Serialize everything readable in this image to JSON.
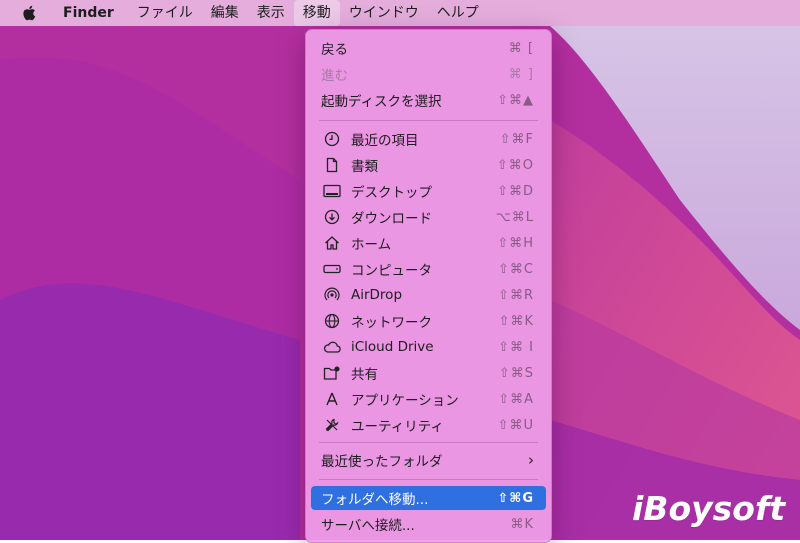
{
  "menubar": {
    "app_name": "Finder",
    "menus": [
      "ファイル",
      "編集",
      "表示",
      "移動",
      "ウインドウ",
      "ヘルプ"
    ]
  },
  "go_menu": {
    "items": [
      {
        "label": "戻る",
        "shortcut": "⌘ ["
      },
      {
        "label": "進む",
        "shortcut": "⌘ ]",
        "disabled": true
      },
      {
        "label": "起動ディスクを選択",
        "shortcut": "⇧⌘▲"
      },
      {
        "label": "最近の項目",
        "shortcut": "⇧⌘F",
        "icon": "clock-icon"
      },
      {
        "label": "書類",
        "shortcut": "⇧⌘O",
        "icon": "document-icon"
      },
      {
        "label": "デスクトップ",
        "shortcut": "⇧⌘D",
        "icon": "desktop-icon"
      },
      {
        "label": "ダウンロード",
        "shortcut": "⌥⌘L",
        "icon": "download-icon"
      },
      {
        "label": "ホーム",
        "shortcut": "⇧⌘H",
        "icon": "home-icon"
      },
      {
        "label": "コンピュータ",
        "shortcut": "⇧⌘C",
        "icon": "computer-icon"
      },
      {
        "label": "AirDrop",
        "shortcut": "⇧⌘R",
        "icon": "airdrop-icon"
      },
      {
        "label": "ネットワーク",
        "shortcut": "⇧⌘K",
        "icon": "network-icon"
      },
      {
        "label": "iCloud Drive",
        "shortcut": "⇧⌘ I",
        "icon": "cloud-icon"
      },
      {
        "label": "共有",
        "shortcut": "⇧⌘S",
        "icon": "shared-folder-icon"
      },
      {
        "label": "アプリケーション",
        "shortcut": "⇧⌘A",
        "icon": "applications-icon"
      },
      {
        "label": "ユーティリティ",
        "shortcut": "⇧⌘U",
        "icon": "utilities-icon"
      },
      {
        "label": "最近使ったフォルダ"
      },
      {
        "label": "フォルダへ移動...",
        "shortcut": "⇧⌘G"
      },
      {
        "label": "サーバへ接続...",
        "shortcut": "⌘K"
      }
    ]
  },
  "watermark": "iBoysoft",
  "colors": {
    "highlight": "#2f6fe0",
    "menu_background": "#ee9ee8",
    "desktop_pink": "#c9379a",
    "desktop_purple": "#7a28b8"
  }
}
